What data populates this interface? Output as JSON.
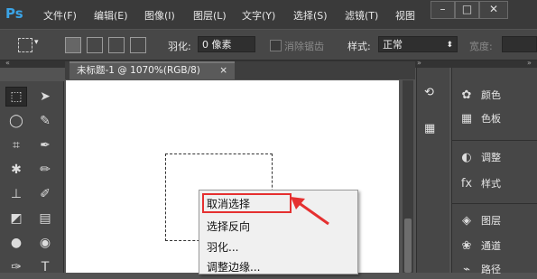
{
  "app": {
    "logo": "Ps"
  },
  "menu": [
    "文件(F)",
    "编辑(E)",
    "图像(I)",
    "图层(L)",
    "文字(Y)",
    "选择(S)",
    "滤镜(T)",
    "视图"
  ],
  "window_controls": {
    "minimize": "–",
    "restore": "□",
    "close": "✕"
  },
  "options": {
    "feather_label": "羽化:",
    "feather_value": "0 像素",
    "antialias_label": "消除锯齿",
    "style_label": "样式:",
    "style_value": "正常",
    "width_label": "宽度:"
  },
  "document": {
    "tab_title": "未标题-1 @ 1070%(RGB/8)",
    "tab_close": "×"
  },
  "panels": {
    "color": "颜色",
    "swatches": "色板",
    "adjustments": "调整",
    "styles": "样式",
    "layers": "图层",
    "channels": "通道",
    "paths": "路径"
  },
  "context_menu": {
    "items": [
      "取消选择",
      "选择反向",
      "羽化...",
      "调整边缘..."
    ],
    "highlight_color": "#e53030"
  },
  "colors": {
    "accent_logo": "#3ba4e6",
    "annotation": "#e53030"
  }
}
